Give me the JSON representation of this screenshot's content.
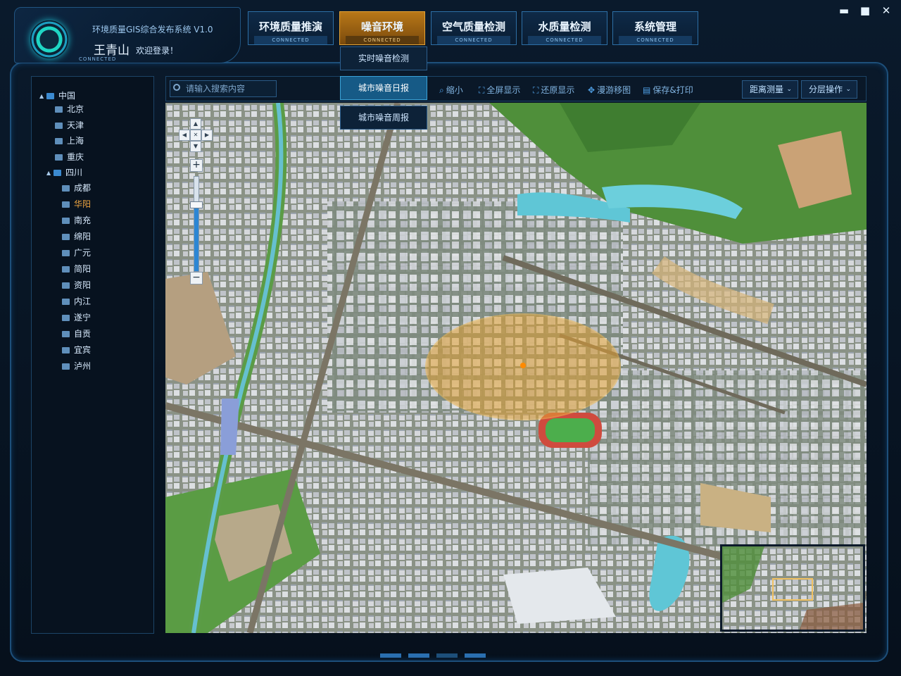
{
  "app": {
    "system_title": "环境质量GIS综合发布系统 V1.0",
    "user_name": "王青山",
    "welcome": "欢迎登录！",
    "connected": "CONNECTED"
  },
  "window_controls": {
    "minimize": "▬",
    "maximize": "■",
    "close": "✕"
  },
  "nav": {
    "tabs": [
      {
        "label": "环境质量推演",
        "status": "CONNECTED",
        "active": false
      },
      {
        "label": "噪音环境",
        "status": "CONNECTED",
        "active": true
      },
      {
        "label": "空气质量检测",
        "status": "CONNECTED",
        "active": false
      },
      {
        "label": "水质量检测",
        "status": "CONNECTED",
        "active": false
      },
      {
        "label": "系统管理",
        "status": "CONNECTED",
        "active": false
      }
    ],
    "dropdown": [
      {
        "label": "实时噪音检测"
      },
      {
        "label": "城市噪音日报",
        "selected": true
      },
      {
        "label": "城市噪音周报"
      }
    ]
  },
  "sidebar": {
    "root": "中国",
    "items": [
      "北京",
      "天津",
      "上海",
      "重庆"
    ],
    "province": "四川",
    "cities": [
      "成都",
      "华阳",
      "南充",
      "绵阳",
      "广元",
      "简阳",
      "资阳",
      "内江",
      "遂宁",
      "自贡",
      "宜宾",
      "泸州"
    ],
    "highlighted_city": "华阳"
  },
  "toolbar": {
    "search_placeholder": "请输入搜索内容",
    "buttons": [
      "缩小",
      "全屏显示",
      "还原显示",
      "漫游移图",
      "保存&打印"
    ],
    "distance": "距离测量",
    "layers": "分层操作"
  },
  "map": {
    "zoom_level_fraction": 0.7,
    "colors": {
      "highlight": "#e4a234",
      "water": "#5fc6d6",
      "green": "#4f9a3a",
      "buildings": "#c9ccd2"
    }
  }
}
